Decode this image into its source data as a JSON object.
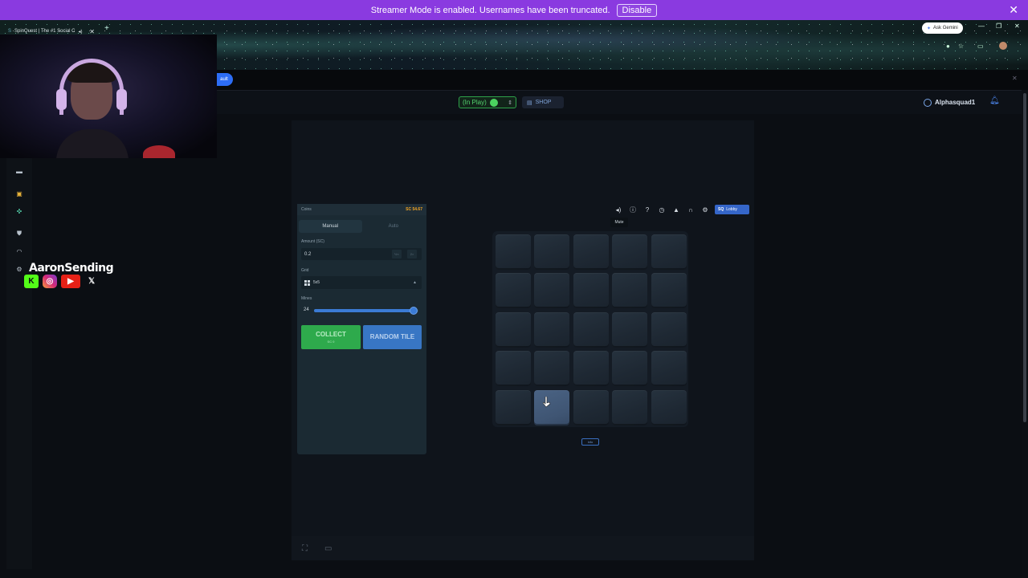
{
  "banner": {
    "message": "Streamer Mode is enabled. Usernames have been truncated.",
    "disable_label": "Disable"
  },
  "browser": {
    "tab_title": "SpinQuest | The #1 Social C",
    "ask_gemini": "Ask Gemini"
  },
  "page_strip": {
    "pill_label": "ault"
  },
  "header": {
    "status_label": "(In Play)",
    "shop_label": "SHOP",
    "username": "Alphasquad1"
  },
  "stream_overlay": {
    "name": "AaronSending"
  },
  "panel": {
    "coins_label": "Coins",
    "balance": "SC 54.67",
    "tabs": [
      "Manual",
      "Auto"
    ],
    "amount_label": "Amount (SC)",
    "amount_value": "0.2",
    "amount_half": "½×",
    "amount_double": "2×",
    "grid_label": "Grid",
    "grid_value": "5x5",
    "mines_label": "Mines",
    "mines_value": "24",
    "mines_fraction": 0.96,
    "collect_label": "COLLECT",
    "collect_sub": "SC 0",
    "random_label": "RANDOM TILE"
  },
  "toolbar": {
    "lobby_label": "Lobby",
    "tooltip": "Mute",
    "icons": [
      "speaker-icon",
      "info-icon",
      "help-icon",
      "history-icon",
      "stats-icon",
      "headphones-icon",
      "gear-icon"
    ]
  },
  "board": {
    "rows": 5,
    "cols": 5,
    "hovered": [
      4,
      1
    ],
    "footer_label": "info"
  },
  "colors": {
    "accent_blue": "#3566c9",
    "collect_green": "#2eaa4c",
    "balance_orange": "#f5a623",
    "banner_purple": "#8a3ae0"
  }
}
